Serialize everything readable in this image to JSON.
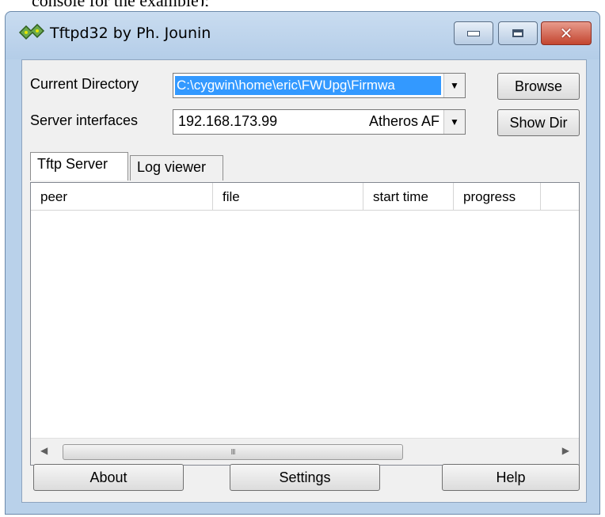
{
  "page_caption": "console for the example);",
  "window": {
    "title": "Tftpd32 by Ph. Jounin"
  },
  "fields": {
    "current_directory_label": "Current Directory",
    "current_directory_value": "C:\\cygwin\\home\\eric\\FWUpg\\Firmwa",
    "server_interfaces_label": "Server interfaces",
    "server_ip": "192.168.173.99",
    "server_adapter": "Atheros AF"
  },
  "buttons": {
    "browse": "Browse",
    "show_dir": "Show Dir",
    "about": "About",
    "settings": "Settings",
    "help": "Help"
  },
  "tabs": [
    {
      "label": "Tftp Server",
      "active": true
    },
    {
      "label": "Log viewer",
      "active": false
    }
  ],
  "table": {
    "columns": [
      "peer",
      "file",
      "start time",
      "progress"
    ],
    "rows": []
  },
  "scrollbar": {
    "thumb_grip": "III"
  },
  "colors": {
    "selection": "#3399ff",
    "close_button": "#c3452f",
    "title_bar": "#b9d1ea"
  }
}
